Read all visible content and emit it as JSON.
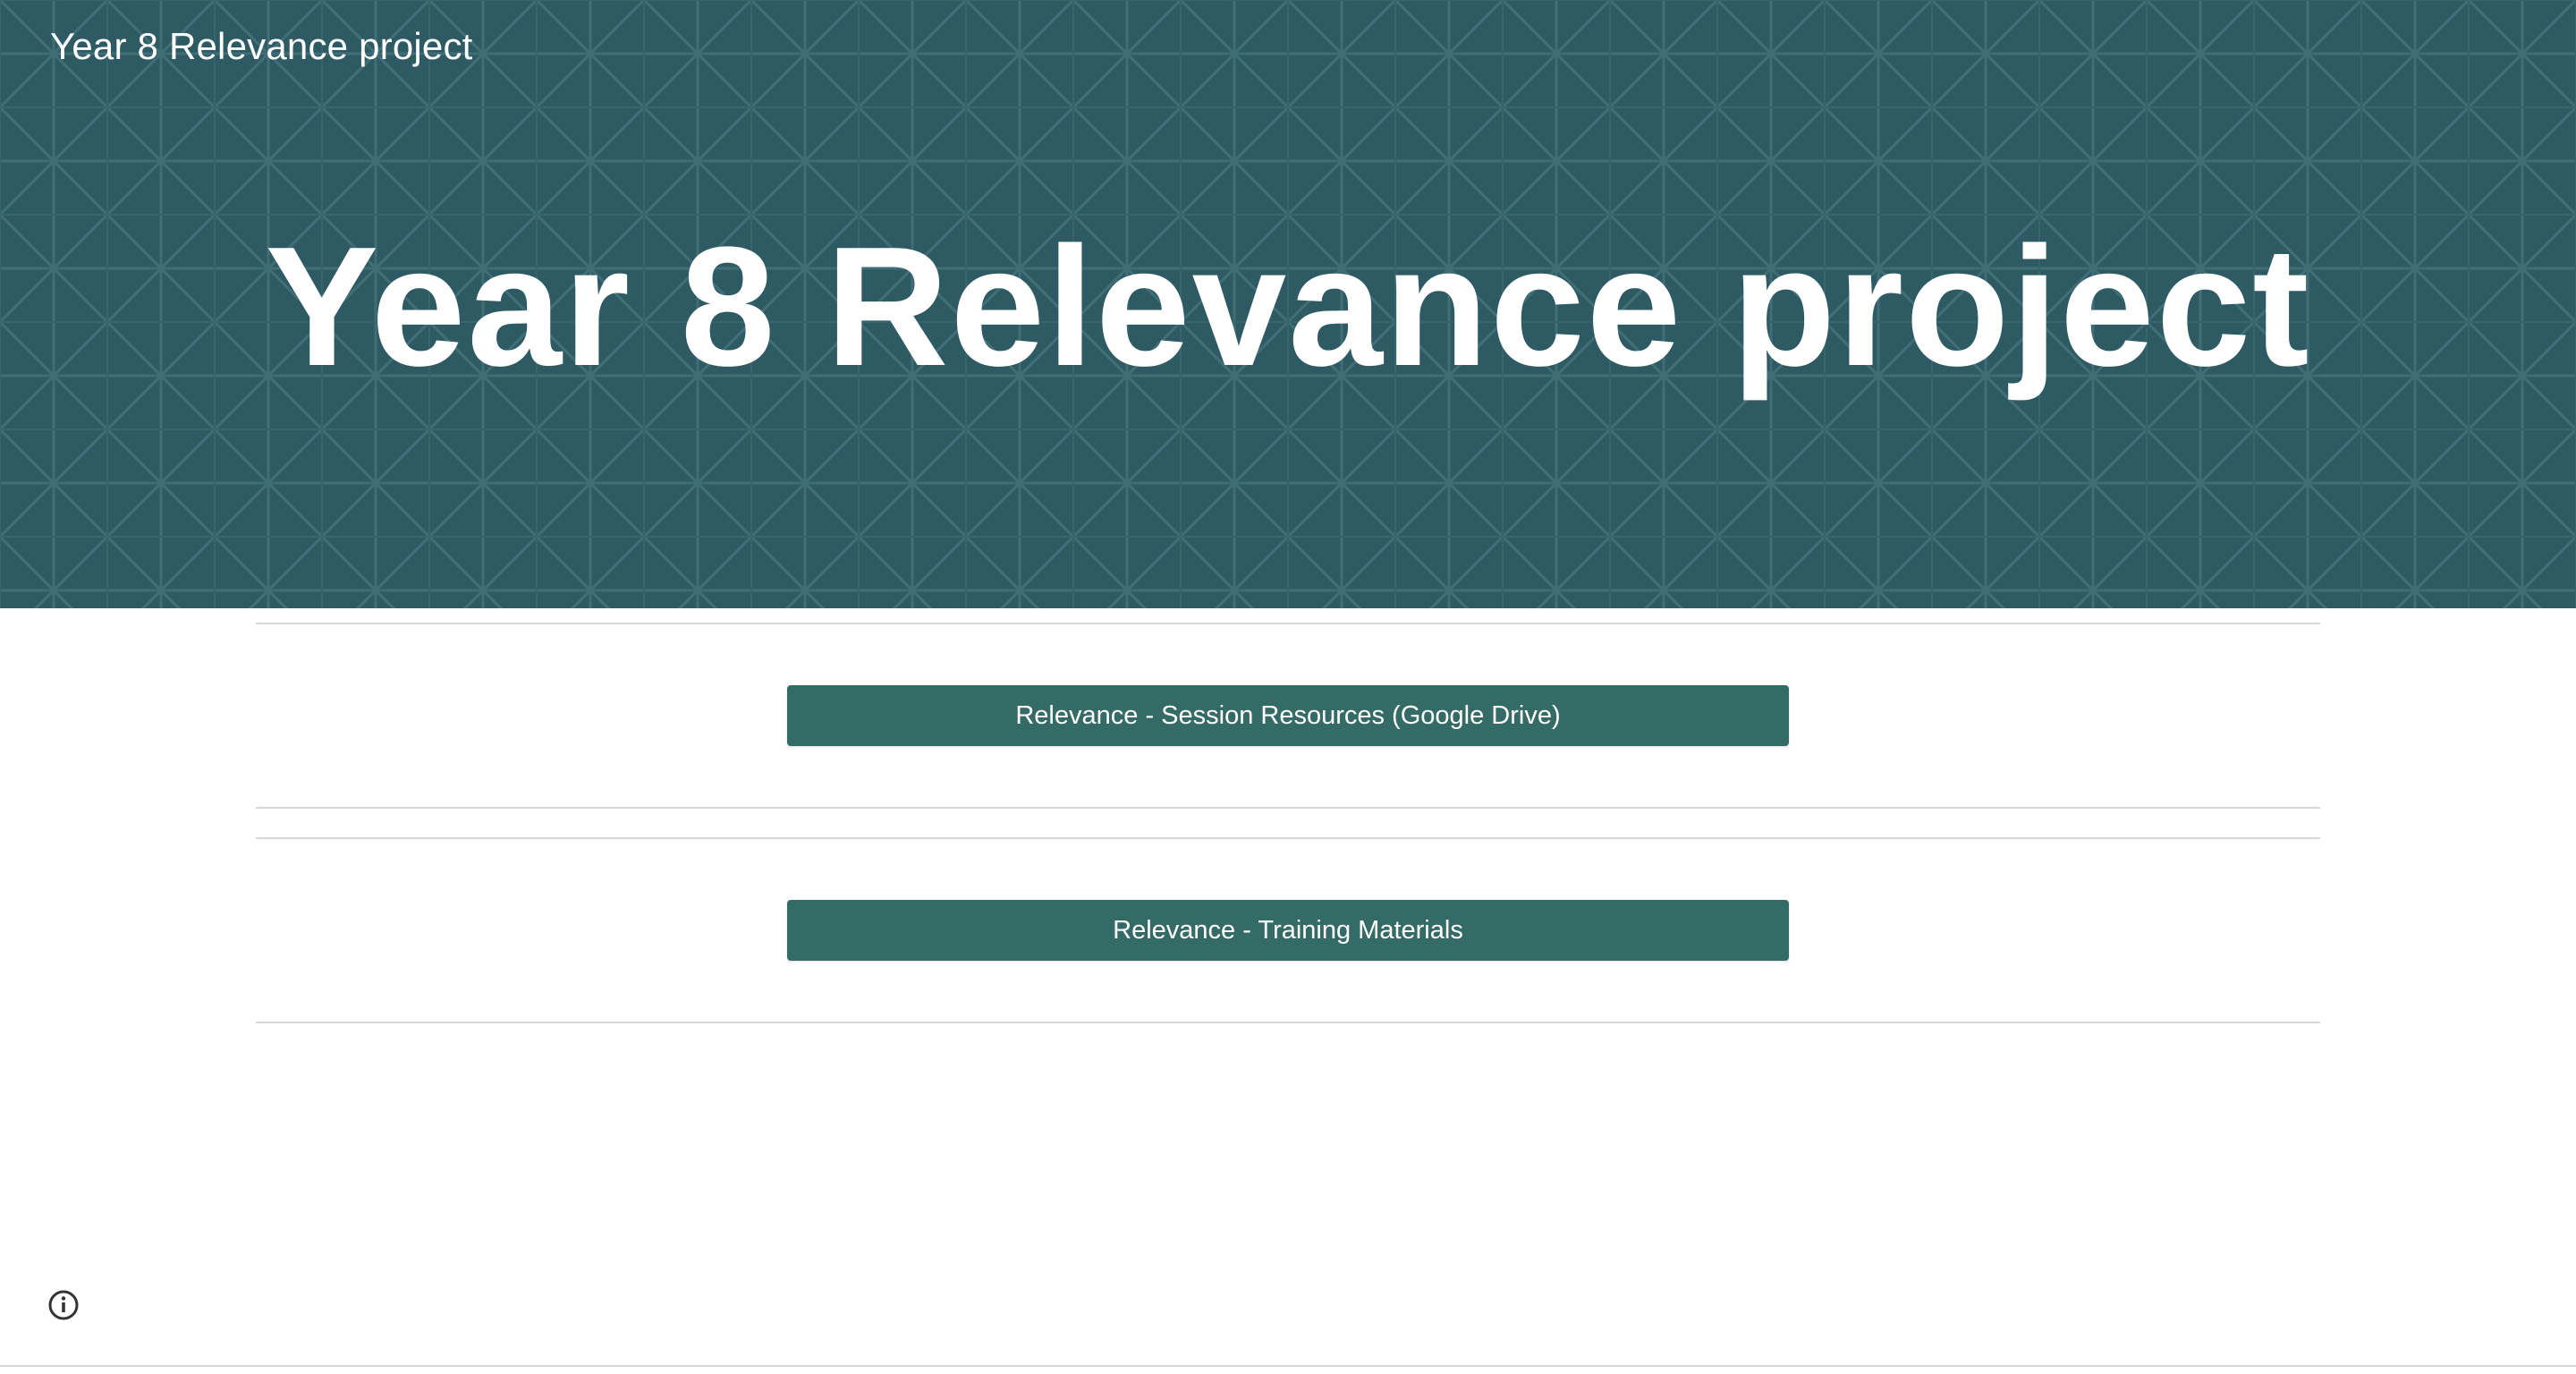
{
  "header": {
    "site_title": "Year 8 Relevance project"
  },
  "hero": {
    "title": "Year 8 Relevance project"
  },
  "sections": [
    {
      "button_label": "Relevance - Session Resources (Google Drive)"
    },
    {
      "button_label": "Relevance - Training Materials"
    }
  ],
  "footer": {
    "info_icon": "info-icon"
  },
  "colors": {
    "banner": "#2e5a63",
    "button": "#356b66",
    "divider": "#d6d6d6"
  }
}
